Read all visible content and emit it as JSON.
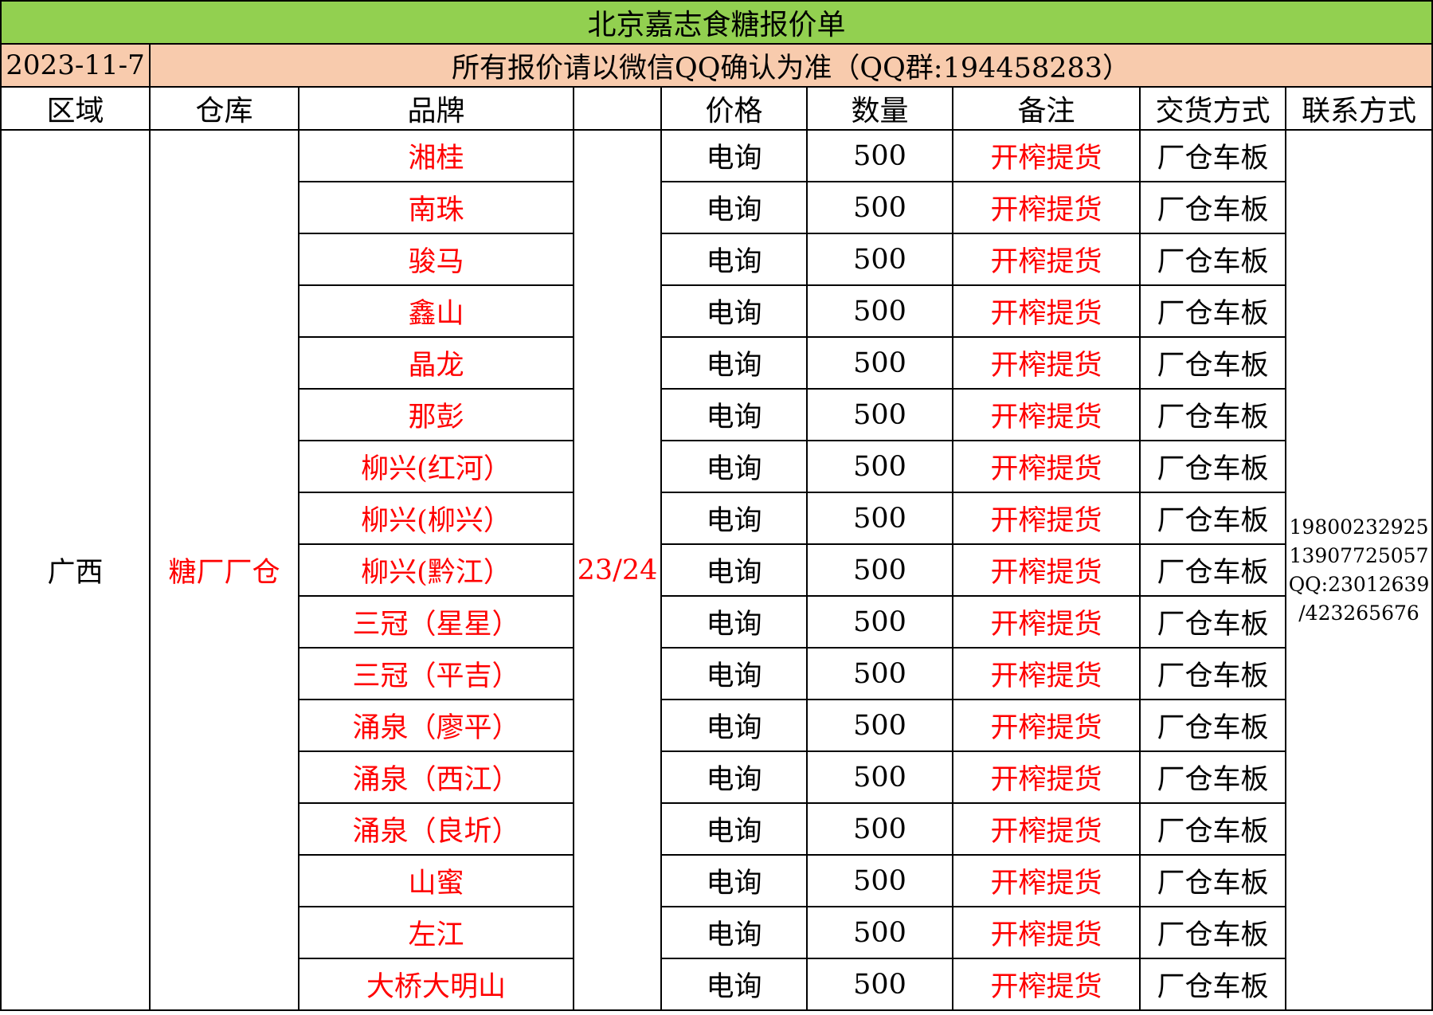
{
  "title": "北京嘉志食糖报价单",
  "date": "2023-11-7",
  "notice": "所有报价请以微信QQ确认为准（QQ群:194458283）",
  "headers": {
    "region": "区域",
    "warehouse": "仓库",
    "brand": "品牌",
    "season": "",
    "price": "价格",
    "quantity": "数量",
    "remark": "备注",
    "delivery": "交货方式",
    "contact": "联系方式"
  },
  "group": {
    "region": "广西",
    "warehouse": "糖厂厂仓",
    "season": "23/24",
    "contact": [
      "19800232925",
      "13907725057",
      "QQ:23012639",
      "/423265676"
    ]
  },
  "rows": [
    {
      "brand": "湘桂",
      "price": "电询",
      "quantity": "500",
      "remark": "开榨提货",
      "delivery": "厂仓车板"
    },
    {
      "brand": "南珠",
      "price": "电询",
      "quantity": "500",
      "remark": "开榨提货",
      "delivery": "厂仓车板"
    },
    {
      "brand": "骏马",
      "price": "电询",
      "quantity": "500",
      "remark": "开榨提货",
      "delivery": "厂仓车板"
    },
    {
      "brand": "鑫山",
      "price": "电询",
      "quantity": "500",
      "remark": "开榨提货",
      "delivery": "厂仓车板"
    },
    {
      "brand": "晶龙",
      "price": "电询",
      "quantity": "500",
      "remark": "开榨提货",
      "delivery": "厂仓车板"
    },
    {
      "brand": "那彭",
      "price": "电询",
      "quantity": "500",
      "remark": "开榨提货",
      "delivery": "厂仓车板"
    },
    {
      "brand": "柳兴(红河）",
      "price": "电询",
      "quantity": "500",
      "remark": "开榨提货",
      "delivery": "厂仓车板"
    },
    {
      "brand": "柳兴(柳兴）",
      "price": "电询",
      "quantity": "500",
      "remark": "开榨提货",
      "delivery": "厂仓车板"
    },
    {
      "brand": "柳兴(黔江）",
      "price": "电询",
      "quantity": "500",
      "remark": "开榨提货",
      "delivery": "厂仓车板"
    },
    {
      "brand": "三冠（星星）",
      "price": "电询",
      "quantity": "500",
      "remark": "开榨提货",
      "delivery": "厂仓车板"
    },
    {
      "brand": "三冠（平吉）",
      "price": "电询",
      "quantity": "500",
      "remark": "开榨提货",
      "delivery": "厂仓车板"
    },
    {
      "brand": "涌泉（廖平）",
      "price": "电询",
      "quantity": "500",
      "remark": "开榨提货",
      "delivery": "厂仓车板"
    },
    {
      "brand": "涌泉（西江）",
      "price": "电询",
      "quantity": "500",
      "remark": "开榨提货",
      "delivery": "厂仓车板"
    },
    {
      "brand": "涌泉（良圻）",
      "price": "电询",
      "quantity": "500",
      "remark": "开榨提货",
      "delivery": "厂仓车板"
    },
    {
      "brand": "山蜜",
      "price": "电询",
      "quantity": "500",
      "remark": "开榨提货",
      "delivery": "厂仓车板"
    },
    {
      "brand": "左江",
      "price": "电询",
      "quantity": "500",
      "remark": "开榨提货",
      "delivery": "厂仓车板"
    },
    {
      "brand": "大桥大明山",
      "price": "电询",
      "quantity": "500",
      "remark": "开榨提货",
      "delivery": "厂仓车板"
    }
  ],
  "colors": {
    "title_bg": "#92d050",
    "notice_bg": "#f8cbad",
    "highlight_text": "#ff0000"
  }
}
